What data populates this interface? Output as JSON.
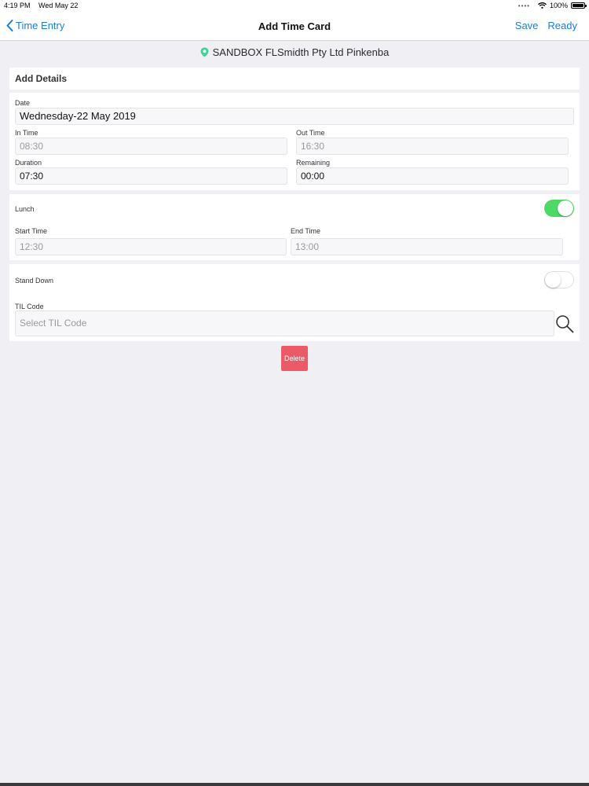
{
  "status_bar": {
    "time": "4:19 PM",
    "date": "Wed May 22",
    "battery": "100%",
    "icons": [
      "signal-dots-icon",
      "wifi-icon",
      "battery-icon"
    ]
  },
  "nav": {
    "back_label": "Time Entry",
    "title": "Add Time Card",
    "save_label": "Save",
    "ready_label": "Ready"
  },
  "location": {
    "icon": "map-pin-icon",
    "text": "SANDBOX FLSmidth Pty Ltd Pinkenba"
  },
  "details": {
    "title": "Add Details",
    "date_label": "Date",
    "date_value": "Wednesday-22 May 2019",
    "in_time_label": "In Time",
    "in_time_placeholder": "08:30",
    "out_time_label": "Out Time",
    "out_time_placeholder": "16:30",
    "duration_label": "Duration",
    "duration_value": "07:30",
    "remaining_label": "Remaining",
    "remaining_value": "00:00"
  },
  "lunch": {
    "label": "Lunch",
    "enabled": true,
    "start_label": "Start Time",
    "start_placeholder": "12:30",
    "end_label": "End Time",
    "end_placeholder": "13:00"
  },
  "stand_down": {
    "label": "Stand Down",
    "enabled": false,
    "til_label": "TIL Code",
    "til_placeholder": "Select TIL Code"
  },
  "delete_label": "Delete",
  "colors": {
    "accent": "#1a7ed6",
    "toggle_on": "#4cd964",
    "delete": "#ec5a68",
    "location_pin": "#3fd19a"
  }
}
